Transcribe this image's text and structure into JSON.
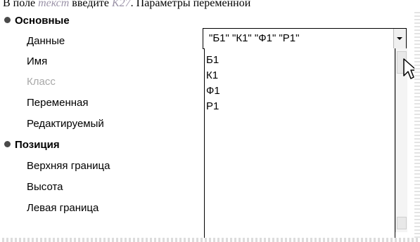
{
  "caption": {
    "text_before": "В поле ",
    "text_italic1": "текст",
    "text_middle": " введите ",
    "text_italic2": "K27",
    "text_after": ". Параметры переменной"
  },
  "properties": {
    "category_main": "Основные",
    "row_data": "Данные",
    "row_name": "Имя",
    "row_class": "Класс",
    "row_variable": "Переменная",
    "row_editable": "Редактируемый",
    "category_position": "Позиция",
    "row_top": "Верхняя граница",
    "row_height": "Высота",
    "row_left": "Левая граница"
  },
  "data_field": {
    "value": "\"Б1\" \"К1\" \"Ф1\" \"Р1\""
  },
  "dropdown": {
    "options": [
      "Б1",
      "К1",
      "Ф1",
      "Р1"
    ]
  },
  "icons": {
    "category_bullet": "bullet-icon",
    "dropdown_arrow": "chevron-down-icon",
    "cursor": "pointer-cursor-icon"
  }
}
